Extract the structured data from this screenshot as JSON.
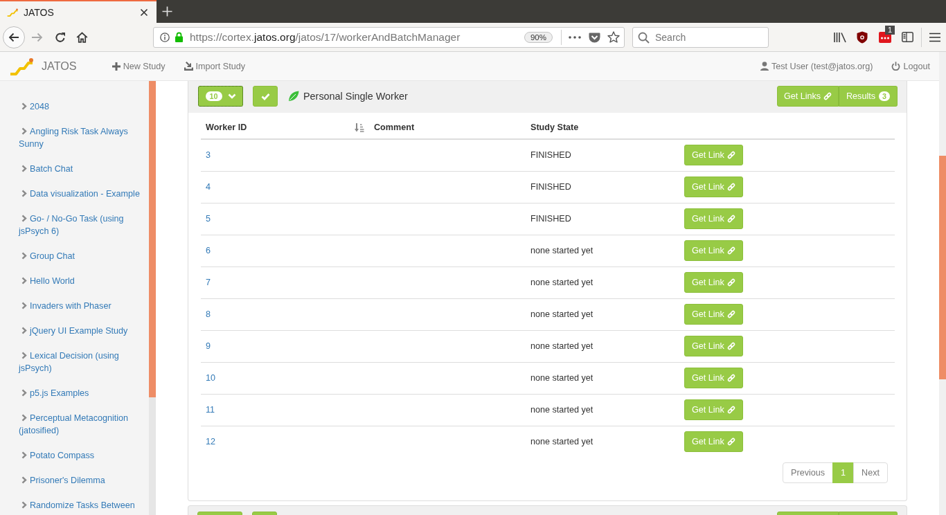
{
  "browser": {
    "tabs": [
      {
        "title": "JATOS",
        "selected": true
      }
    ],
    "forward_disabled": true,
    "url": {
      "prefix": "https://cortex.",
      "domain": "jatos.org",
      "path": "/jatos/17/workerAndBatchManager"
    },
    "zoom": "90%",
    "search": {
      "placeholder": "Search"
    },
    "extension_badge": "1"
  },
  "navbar": {
    "brand": "JATOS",
    "links": [
      "New Study",
      "Import Study"
    ],
    "user": "Test User (test@jatos.org)",
    "logout": "Logout"
  },
  "sidebar": {
    "items": [
      "2048",
      "Angling Risk Task Always Sunny",
      "Batch Chat",
      "Data visualization - Example",
      "Go- / No-Go Task (using jsPsych 6)",
      "Group Chat",
      "Hello World",
      "Invaders with Phaser",
      "jQuery UI Example Study",
      "Lexical Decision (using jsPsych)",
      "p5.js Examples",
      "Perceptual Metacognition (jatosified)",
      "Potato Compass",
      "Prisoner's Dilemma",
      "Randomize Tasks Between"
    ]
  },
  "batch_panel": {
    "dropdown": {
      "count": "10",
      "focused": true
    },
    "title": "Personal Single Worker",
    "get_links": "Get Links",
    "results": {
      "label": "Results",
      "badge": "3"
    }
  },
  "table": {
    "columns": [
      {
        "label": "Worker ID",
        "sorted": true
      },
      {
        "label": "Comment",
        "sorted": false
      },
      {
        "label": "Study State",
        "sorted": false
      }
    ],
    "rows": [
      {
        "worker_id": "3",
        "study_state": "FINISHED",
        "button": "Get Link"
      },
      {
        "worker_id": "4",
        "study_state": "FINISHED",
        "button": "Get Link"
      },
      {
        "worker_id": "5",
        "study_state": "FINISHED",
        "button": "Get Link"
      },
      {
        "worker_id": "6",
        "study_state": "none started yet",
        "button": "Get Link"
      },
      {
        "worker_id": "7",
        "study_state": "none started yet",
        "button": "Get Link"
      },
      {
        "worker_id": "8",
        "study_state": "none started yet",
        "button": "Get Link"
      },
      {
        "worker_id": "9",
        "study_state": "none started yet",
        "button": "Get Link"
      },
      {
        "worker_id": "10",
        "study_state": "none started yet",
        "button": "Get Link"
      },
      {
        "worker_id": "11",
        "study_state": "none started yet",
        "button": "Get Link"
      },
      {
        "worker_id": "12",
        "study_state": "none started yet",
        "button": "Get Link"
      }
    ]
  },
  "pagination": [
    {
      "label": "Previous",
      "selected": false,
      "disabled": true
    },
    {
      "label": "1",
      "selected": true,
      "disabled": false
    },
    {
      "label": "Next",
      "selected": false,
      "disabled": true
    }
  ]
}
